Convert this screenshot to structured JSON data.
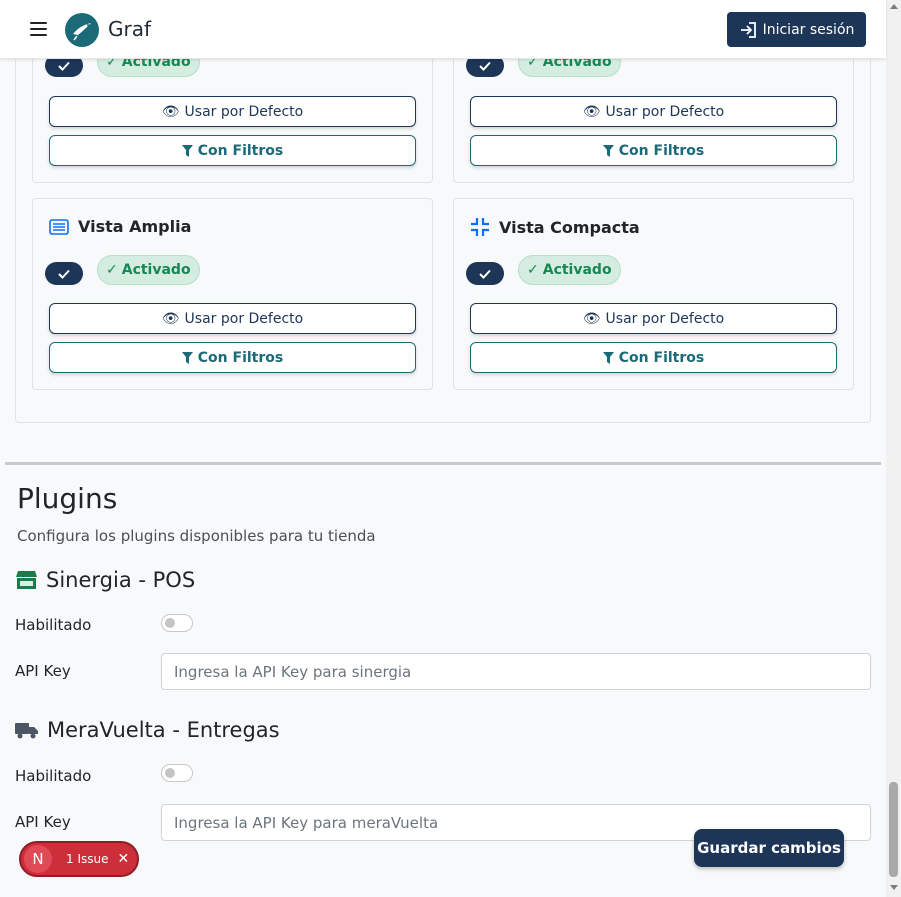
{
  "header": {
    "brand": "Graf",
    "login_label": "Iniciar sesión"
  },
  "view_cards": [
    {
      "title": "",
      "status": "Activado",
      "default_label": "Usar por Defecto",
      "filter_label": "Con Filtros"
    },
    {
      "title": "",
      "status": "Activado",
      "default_label": "Usar por Defecto",
      "filter_label": "Con Filtros"
    },
    {
      "title": "Vista Amplia",
      "icon": "list-icon",
      "status": "Activado",
      "default_label": "Usar por Defecto",
      "filter_label": "Con Filtros"
    },
    {
      "title": "Vista Compacta",
      "icon": "compress-icon",
      "status": "Activado",
      "default_label": "Usar por Defecto",
      "filter_label": "Con Filtros"
    }
  ],
  "plugins": {
    "title": "Plugins",
    "subtitle": "Configura los plugins disponibles para tu tienda",
    "items": [
      {
        "name": "Sinergia - POS",
        "icon": "store-icon",
        "enabled_label": "Habilitado",
        "enabled": false,
        "api_label": "API Key",
        "api_placeholder": "Ingresa la API Key para sinergia",
        "api_value": ""
      },
      {
        "name": "MeraVuelta - Entregas",
        "icon": "truck-icon",
        "enabled_label": "Habilitado",
        "enabled": false,
        "api_label": "API Key",
        "api_placeholder": "Ingresa la API Key para meraVuelta",
        "api_value": ""
      }
    ]
  },
  "actions": {
    "save_label": "Guardar cambios"
  },
  "issues": {
    "badge_letter": "N",
    "label": "1 Issue"
  },
  "colors": {
    "primary": "#1d3557",
    "teal": "#1b6a78",
    "success": "#198754",
    "icon_blue": "#0d6efd",
    "store_green": "#1e7a4a",
    "issue_red": "#cc2e3a"
  }
}
